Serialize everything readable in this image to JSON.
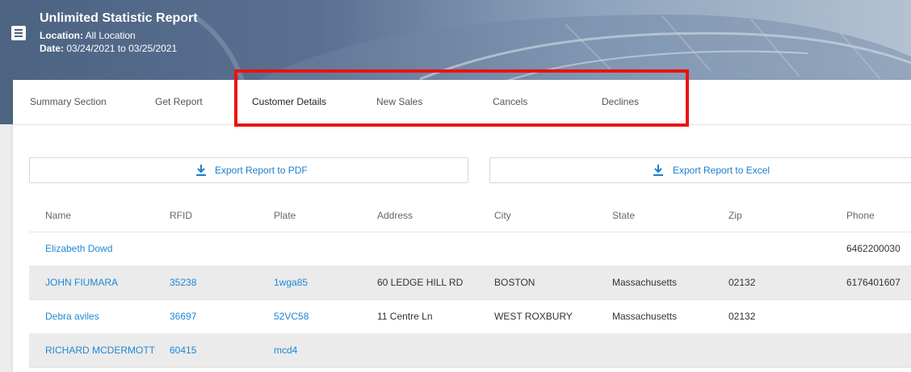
{
  "header": {
    "title": "Unlimited Statistic Report",
    "location_label": "Location:",
    "location_value": "All Location",
    "date_label": "Date:",
    "date_value": "03/24/2021 to 03/25/2021"
  },
  "icons": {
    "menu": "menu-icon",
    "download": "download-icon"
  },
  "colors": {
    "link": "#1e88d6",
    "highlight": "#ee1111",
    "alt_row": "#ebebeb"
  },
  "tabs": [
    {
      "label": "Summary Section"
    },
    {
      "label": "Get Report"
    },
    {
      "label": "Customer Details"
    },
    {
      "label": "New Sales"
    },
    {
      "label": "Cancels"
    },
    {
      "label": "Declines"
    }
  ],
  "active_tab": "Customer Details",
  "export": {
    "pdf_label": "Export Report to PDF",
    "excel_label": "Export Report to Excel"
  },
  "table": {
    "columns": [
      "Name",
      "RFID",
      "Plate",
      "Address",
      "City",
      "State",
      "Zip",
      "Phone"
    ],
    "rows": [
      {
        "name": "Elizabeth Dowd",
        "rfid": "",
        "plate": "",
        "address": "",
        "city": "",
        "state": "",
        "zip": "",
        "phone": "6462200030"
      },
      {
        "name": "JOHN FIUMARA",
        "rfid": "35238",
        "plate": "1wga85",
        "address": "60 LEDGE HILL RD",
        "city": "BOSTON",
        "state": "Massachusetts",
        "zip": "02132",
        "phone": "6176401607"
      },
      {
        "name": "Debra aviles",
        "rfid": "36697",
        "plate": "52VC58",
        "address": "11 Centre Ln",
        "city": "WEST ROXBURY",
        "state": "Massachusetts",
        "zip": "02132",
        "phone": ""
      },
      {
        "name": "RICHARD MCDERMOTT",
        "rfid": "60415",
        "plate": "mcd4",
        "address": "",
        "city": "",
        "state": "",
        "zip": "",
        "phone": ""
      }
    ]
  }
}
